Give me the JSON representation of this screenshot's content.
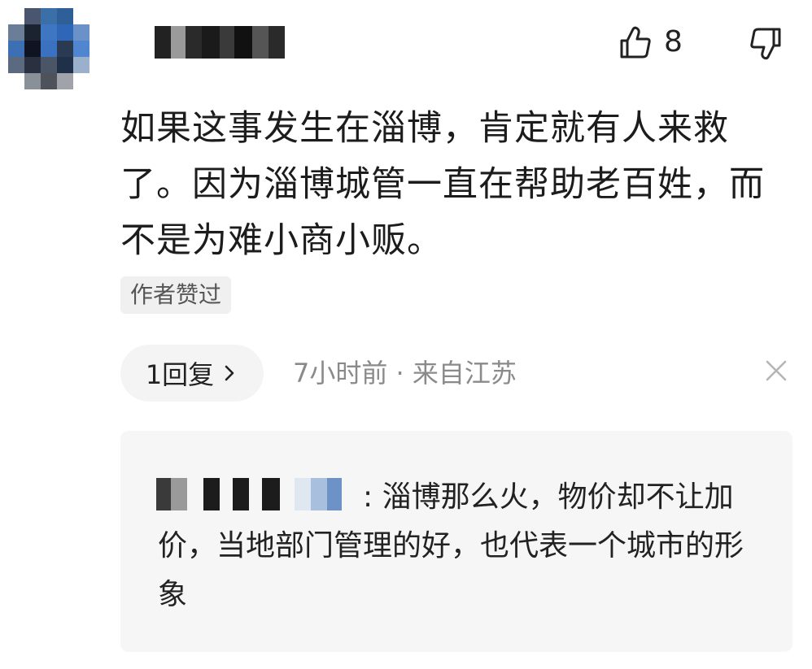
{
  "comment": {
    "like_count": "8",
    "text": "如果这事发生在淄博，肯定就有人来救了。因为淄博城管一直在帮助老百姓，而不是为难小商小贩。",
    "author_badge": "作者赞过",
    "reply_count_label": "1回复",
    "meta": "7小时前 · 来自江苏"
  },
  "reply": {
    "separator": ":",
    "text": "淄博那么火，物价却不让加价，当地部门管理的好，也代表一个城市的形象"
  },
  "icons": {
    "like": "thumbs-up-icon",
    "dislike": "thumbs-down-icon",
    "chevron": "chevron-right-icon",
    "close": "close-icon"
  },
  "colors": {
    "badge_bg": "#f0f0f0",
    "reply_bg": "#f6f6f6",
    "meta_text": "#8a8a8a"
  }
}
